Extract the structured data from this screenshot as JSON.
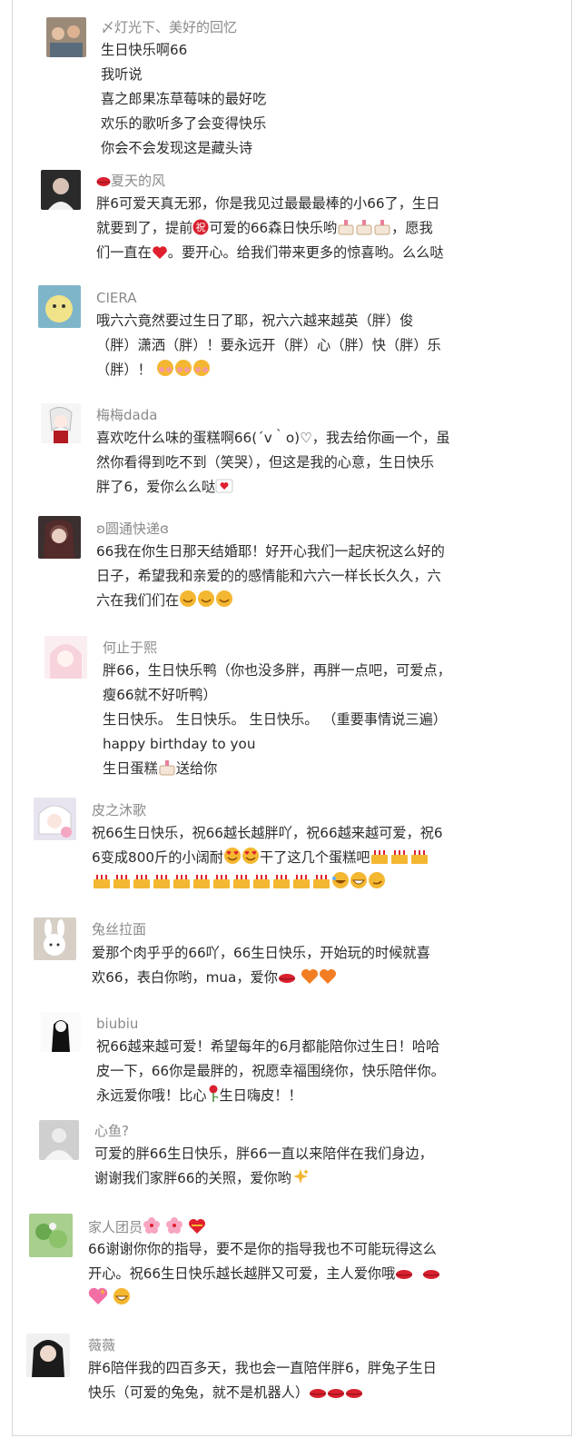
{
  "comments": [
    {
      "name": "〆灯光下、美好的回忆",
      "lines": [
        "生日快乐啊66",
        "我听说",
        "喜之郎果冻草莓味的最好吃",
        "欢乐的歌听多了会变得快乐",
        "你会不会发现这是藏头诗"
      ]
    },
    {
      "name": "夏天的风",
      "lines": [
        "胖6可爱天真无邪，你是我见过最最最棒的小66了，生日",
        "就要到了，提前",
        "可爱的66森日快乐哟",
        "，愿我",
        "们一直在",
        "。要开心。给我们带来更多的惊喜哟。么么哒"
      ]
    },
    {
      "name": "CIERA",
      "lines": [
        "哦六六竟然要过生日了耶，祝六六越来越英（胖）俊",
        "（胖）潇洒（胖）！要永远开（胖）心（胖）快（胖）乐",
        "（胖）！"
      ]
    },
    {
      "name": "梅梅dada",
      "lines": [
        "喜欢吃什么味的蛋糕啊66(´v｀o)♡，我去给你画一个，虽",
        "然你看得到吃不到（笑哭），但这是我的心意，生日快乐",
        "胖了6，爱你么么哒"
      ]
    },
    {
      "name": "ʚ圆通快递ɞ",
      "lines": [
        "66我在你生日那天结婚耶！好开心我们一起庆祝这么好的",
        "日子，希望我和亲爱的的感情能和六六一样长长久久，六",
        "六在我们们在"
      ]
    },
    {
      "name": "何止于熙",
      "lines": [
        "胖66，生日快乐鸭（你也没多胖，再胖一点吧，可爱点，",
        "瘦66就不好听鸭）",
        "生日快乐。 生日快乐。 生日快乐。 （重要事情说三遍）",
        "happy birthday to you",
        "生日蛋糕",
        "送给你"
      ]
    },
    {
      "name": "皮之沐歌",
      "lines": [
        "祝66生日快乐，祝66越长越胖吖，祝66越来越可爱，祝6",
        "6变成800斤的小阔耐",
        "干了这几个蛋糕吧"
      ]
    },
    {
      "name": "兔丝拉面",
      "lines": [
        "爱那个肉乎乎的66吖，66生日快乐，开始玩的时候就喜",
        "欢66，表白你哟，mua，爱你"
      ]
    },
    {
      "name": "biubiu",
      "lines": [
        "祝66越来越可爱！希望每年的6月都能陪你过生日！哈哈",
        "皮一下，66你是最胖的，祝愿幸福围绕你，快乐陪伴你。",
        "永远爱你哦！比心",
        "生日嗨皮！！"
      ]
    },
    {
      "name": "心鱼?",
      "lines": [
        "可爱的胖66生日快乐，胖66一直以来陪伴在我们身边，",
        "谢谢我们家胖66的关照，爱你哟"
      ]
    },
    {
      "name": "家人团员",
      "lines": [
        "66谢谢你你的指导，要不是你的指导我也不可能玩得这么",
        "开心。祝66生日快乐越长越胖又可爱，主人爱你哦"
      ]
    },
    {
      "name": "薇薇",
      "lines": [
        "胖6陪伴我的四百多天，我也会一直陪伴胖6，胖兔子生日",
        "快乐（可爱的兔兔，就不是机器人）"
      ]
    }
  ],
  "colors": {
    "name": "#8a8a8a",
    "text": "#2b2b2b",
    "border": "#d9d9d9",
    "emoji": "#f4b731",
    "heart": "#e0202e"
  }
}
